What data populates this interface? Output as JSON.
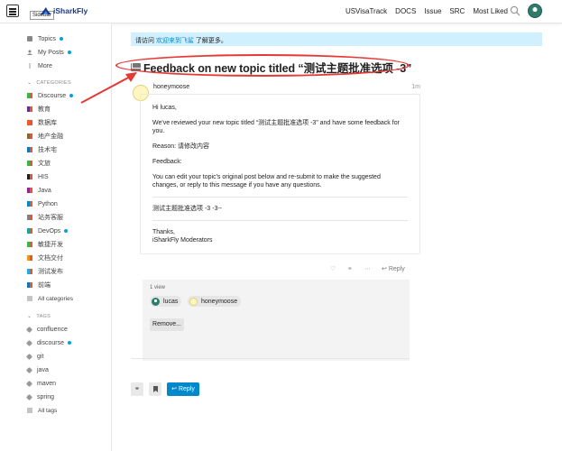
{
  "header": {
    "tooltip": "Sidebar",
    "logo_text": "iSharkFly",
    "nav": [
      "USVisaTrack",
      "DOCS",
      "Issue",
      "SRC",
      "Most Liked"
    ]
  },
  "sidebar": {
    "top_items": [
      {
        "label": "Topics",
        "dot": true
      },
      {
        "label": "My Posts",
        "dot": true
      },
      {
        "label": "More",
        "dot": false
      }
    ],
    "categories_header": "CATEGORIES",
    "categories": [
      {
        "label": "Discourse",
        "color": "#3ab54a",
        "dot": true
      },
      {
        "label": "教育",
        "color": "#652d90",
        "dot": false
      },
      {
        "label": "数据库",
        "color": "#f1592a",
        "dot": false
      },
      {
        "label": "地产金融",
        "color": "#8c6238",
        "dot": false
      },
      {
        "label": "技术宅",
        "color": "#0e76bd",
        "dot": false
      },
      {
        "label": "文旅",
        "color": "#3ab54a",
        "dot": false
      },
      {
        "label": "HIS",
        "color": "#231f20",
        "dot": false
      },
      {
        "label": "Java",
        "color": "#92278f",
        "dot": false
      },
      {
        "label": "Python",
        "color": "#0088cc",
        "dot": false
      },
      {
        "label": "站务客服",
        "color": "#808281",
        "dot": false
      },
      {
        "label": "DevOps",
        "color": "#12a89d",
        "dot": true
      },
      {
        "label": "敏捷开发",
        "color": "#3ab54a",
        "dot": false
      },
      {
        "label": "文档交付",
        "color": "#f7941d",
        "dot": false
      },
      {
        "label": "测试发布",
        "color": "#25aae1",
        "dot": false
      },
      {
        "label": "前端",
        "color": "#0e76bd",
        "dot": false
      }
    ],
    "all_categories": "All categories",
    "tags_header": "TAGS",
    "tags": [
      {
        "label": "confluence",
        "dot": false
      },
      {
        "label": "discourse",
        "dot": true
      },
      {
        "label": "git",
        "dot": false
      },
      {
        "label": "java",
        "dot": false
      },
      {
        "label": "maven",
        "dot": false
      },
      {
        "label": "spring",
        "dot": false
      }
    ],
    "all_tags": "All tags"
  },
  "banner": {
    "prefix": "请访问 ",
    "link": "欢迎来到飞鲨",
    "suffix": " 了解更多。"
  },
  "topic": {
    "title": "Feedback on new topic titled “测试主题批准选项 -3”"
  },
  "post": {
    "username": "honeymoose",
    "time": "1m",
    "greeting": "Hi lucas,",
    "line1": "We've reviewed your new topic titled “测试主题批准选项 -3” and have some feedback for you.",
    "reason": "Reason: 请修改内容",
    "feedback": "Feedback:",
    "line2": "You can edit your topic's original post below and re-submit to make the suggested changes, or reply to this message if you have any questions.",
    "quote": "测试主题批准选项 -3 -3--",
    "thanks": "Thanks,",
    "signature": "iSharkFly Moderators",
    "reply_label": "Reply"
  },
  "participants": {
    "views": "1 view",
    "users": [
      "lucas",
      "honeymoose"
    ],
    "remove_label": "Remove..."
  },
  "footer": {
    "reply_label": "Reply"
  },
  "colors": {
    "accent": "#0088cc",
    "annotation": "#e53935"
  }
}
